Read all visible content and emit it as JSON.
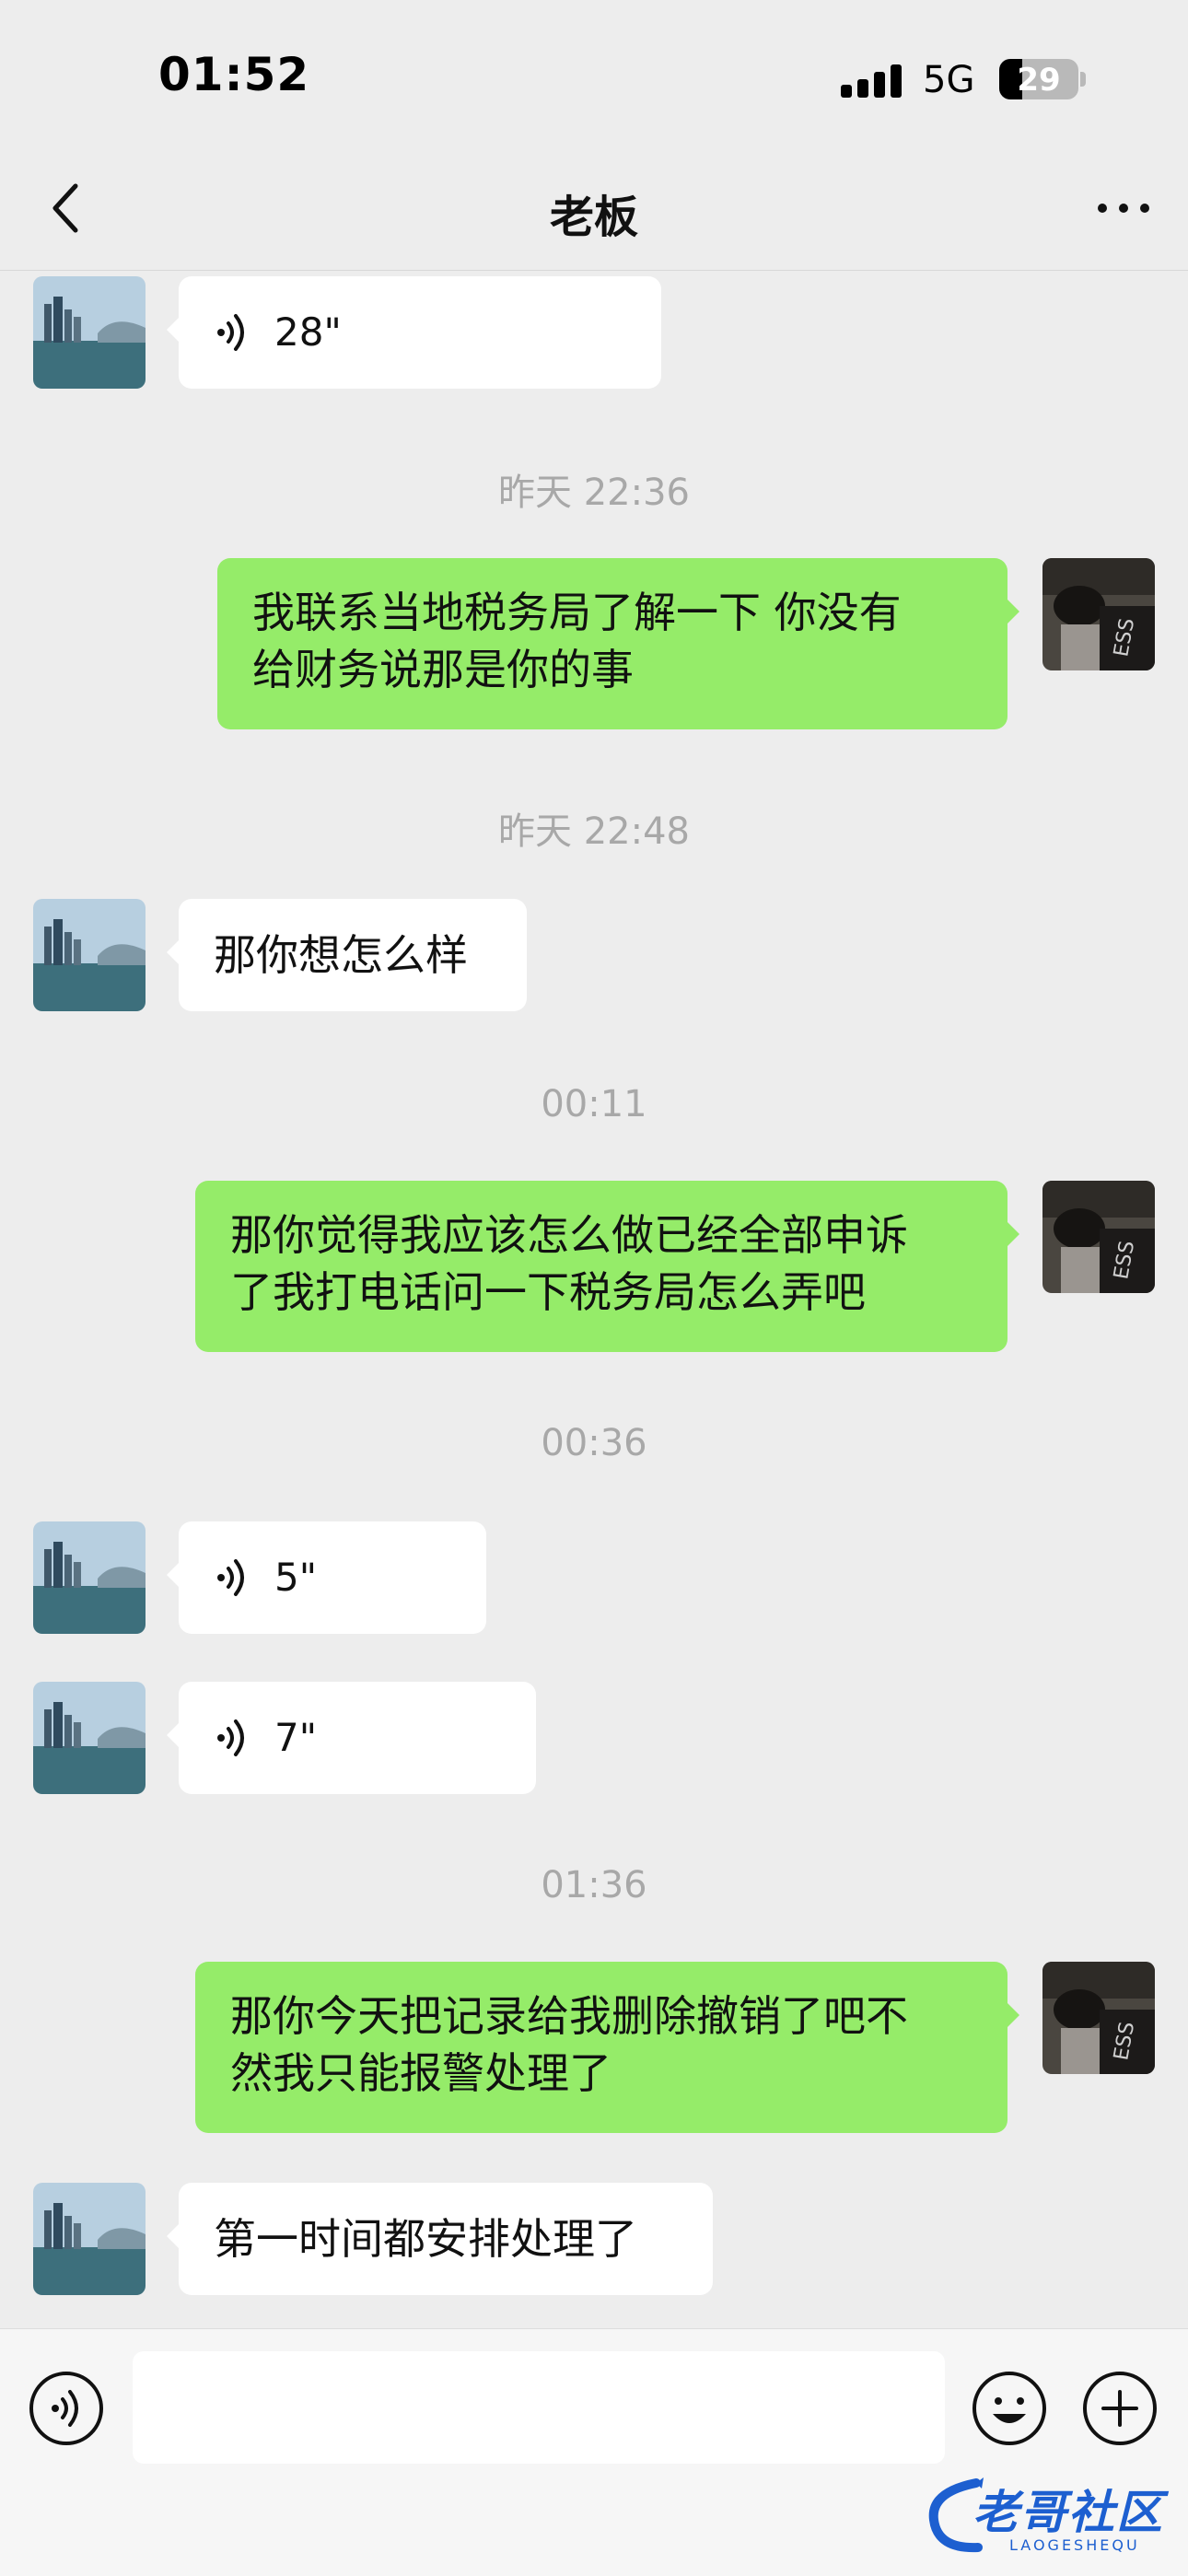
{
  "status_bar": {
    "time": "01:52",
    "network": "5G",
    "battery_level": "29",
    "battery_fraction": 0.29
  },
  "nav": {
    "title": "老板"
  },
  "messages": {
    "m1": {
      "duration": "28\""
    },
    "t1": "昨天 22:36",
    "m2": {
      "lines": [
        "我联系当地税务局了解一下  你没有",
        "给财务说那是你的事"
      ]
    },
    "t2": "昨天 22:48",
    "m3": {
      "text": "那你想怎么样"
    },
    "t3": "00:11",
    "m4": {
      "lines": [
        "那你觉得我应该怎么做已经全部申诉",
        "了我打电话问一下税务局怎么弄吧"
      ]
    },
    "t4": "00:36",
    "m5": {
      "duration": "5\""
    },
    "m6": {
      "duration": "7\""
    },
    "t5": "01:36",
    "m7": {
      "lines": [
        "那你今天把记录给我删除撤销了吧不",
        "然我只能报警处理了"
      ]
    },
    "m8": {
      "text": "第一时间都安排处理了"
    }
  },
  "input_bar": {
    "value": ""
  },
  "watermark": {
    "text": "老哥社区",
    "sub": "LAOGESHEQU"
  },
  "icons": {
    "back": "chevron-left-icon",
    "more": "ellipsis-icon",
    "voice": "voice-wave-icon",
    "emoji": "smiley-icon",
    "plus": "plus-circle-icon"
  },
  "colors": {
    "background": "#ededed",
    "outgoing_bubble": "#95ec69",
    "incoming_bubble": "#ffffff",
    "timestamp": "#a8a8a8"
  }
}
